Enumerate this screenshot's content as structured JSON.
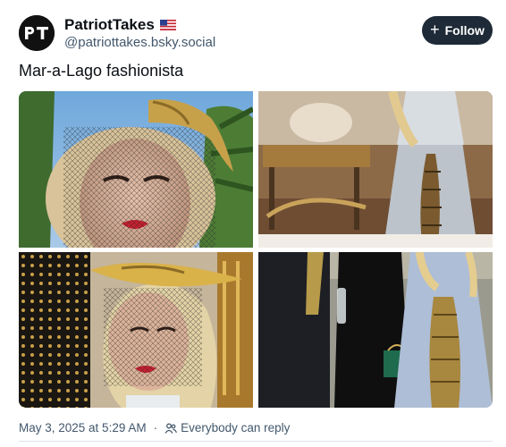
{
  "author": {
    "display_name": "PatriotTakes",
    "flag": "🇺🇸",
    "handle": "@patriottakes.bsky.social",
    "avatar_text": "PT"
  },
  "follow_button": {
    "label": "Follow",
    "icon": "plus-icon"
  },
  "post": {
    "text": "Mar-a-Lago fashionista",
    "images": [
      {
        "name": "woman-veil-lobster-headpiece-photo"
      },
      {
        "name": "woman-lobster-dress-room-photo"
      },
      {
        "name": "woman-veil-gold-lobster-hat-photo"
      },
      {
        "name": "group-lobster-gown-photo"
      }
    ]
  },
  "footer": {
    "timestamp": "May 3, 2025 at 5:29 AM",
    "reply_setting": "Everybody can reply",
    "reply_icon": "people-icon"
  },
  "colors": {
    "follow_bg": "#1e2a37",
    "muted_text": "#42576c",
    "text": "#0b0f14"
  }
}
